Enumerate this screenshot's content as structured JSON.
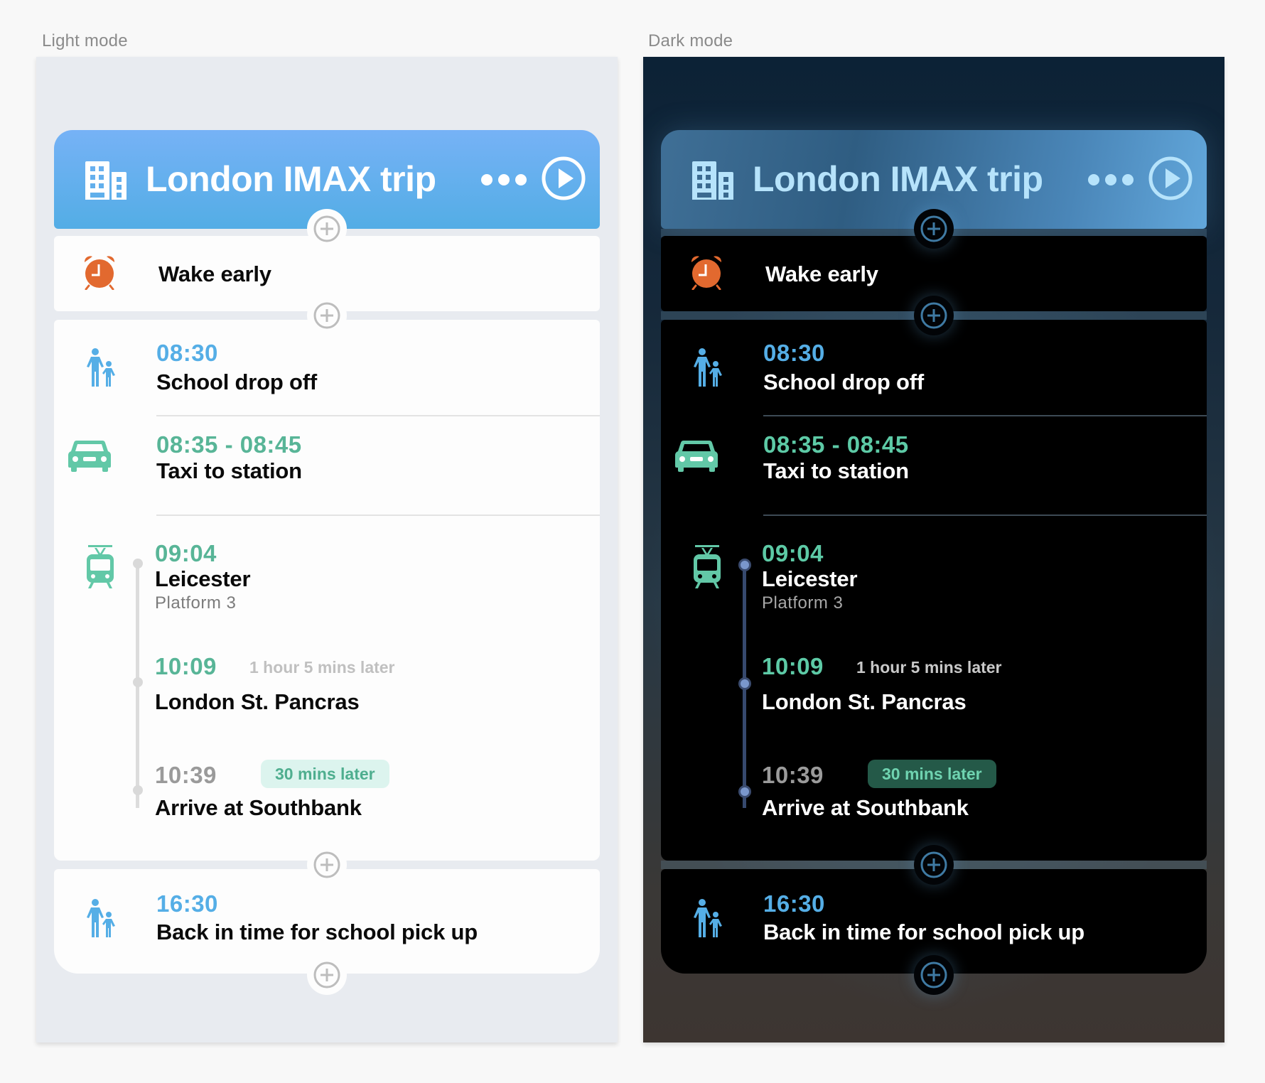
{
  "labels": {
    "light": "Light mode",
    "dark": "Dark mode"
  },
  "trip": {
    "title": "London IMAX trip",
    "icon": "building-icon",
    "more_icon": "ellipsis-icon",
    "play_icon": "play-circle-icon"
  },
  "wake": {
    "title": "Wake early",
    "icon": "alarm-clock-icon"
  },
  "school_drop": {
    "time": "08:30",
    "title": "School drop off",
    "icon": "parent-child-icon"
  },
  "taxi": {
    "time": "08:35 - 08:45",
    "title": "Taxi to station",
    "icon": "car-icon"
  },
  "train": {
    "icon": "tram-icon",
    "departure": {
      "time": "09:04",
      "station": "Leicester",
      "platform": "Platform 3"
    },
    "arrival": {
      "time": "10:09",
      "duration": "1 hour 5 mins later",
      "station": "London St. Pancras"
    },
    "final": {
      "time": "10:39",
      "badge": "30 mins later",
      "title": "Arrive at Southbank"
    }
  },
  "pickup": {
    "time": "16:30",
    "title": "Back in time for school pick up",
    "icon": "parent-child-icon"
  },
  "add_icon": "plus-circle-icon",
  "colors": {
    "accent_blue": "#55aee6",
    "accent_green": "#58b597",
    "alarm_orange": "#e2692f",
    "header_light": "#5eb0ec",
    "header_dark": "#3f6f96"
  }
}
